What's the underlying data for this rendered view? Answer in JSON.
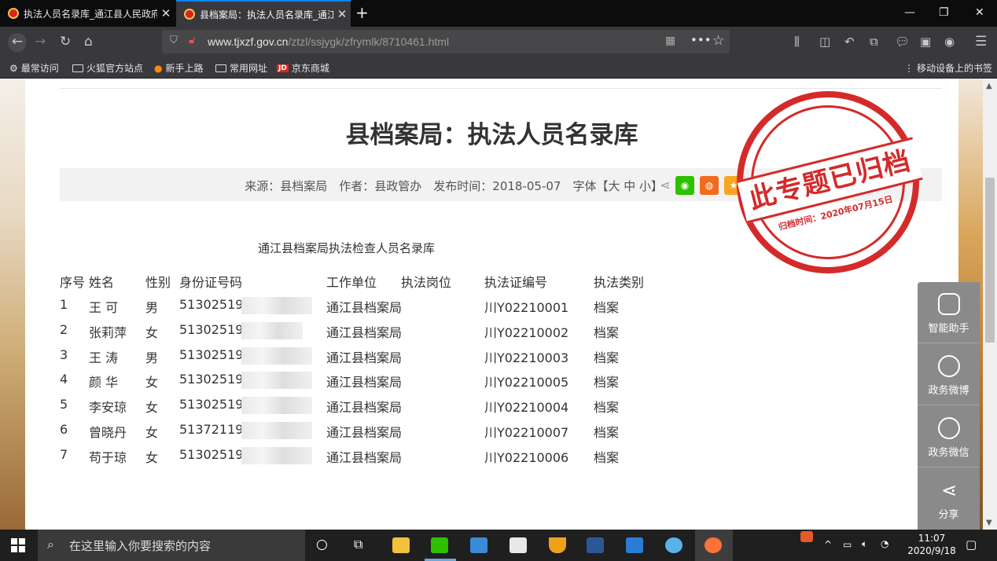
{
  "browser": {
    "tabs": [
      {
        "title": "执法人员名录库_通江县人民政府",
        "active": false
      },
      {
        "title": "县档案局：执法人员名录库_通江县",
        "active": true
      }
    ],
    "url_domain": "www.tjxzf.gov.cn",
    "url_path": "/ztzl/ssjygk/zfrymlk/8710461.html",
    "bookmarks": [
      "最常访问",
      "火狐官方站点",
      "新手上路",
      "常用网址",
      "京东商城"
    ],
    "mobile_bookmarks": "移动设备上的书签"
  },
  "article": {
    "title": "县档案局：执法人员名录库",
    "meta": "来源：县档案局　作者：县政管办　发布时间：2018-05-07　字体【大 中 小】",
    "stamp_text": "此专题已归档",
    "stamp_date": "归档时间：2020年07月15日",
    "subtitle": "通江县档案局执法检查人员名录库",
    "headers": [
      "序号",
      "姓名",
      "性别",
      "身份证号码",
      "工作单位",
      "执法岗位",
      "执法证编号",
      "执法类别"
    ],
    "rows": [
      {
        "no": "1",
        "name": "王 可",
        "sex": "男",
        "id": "513025196",
        "unit": "通江县档案局",
        "cert": "川Y02210001",
        "type": "档案"
      },
      {
        "no": "2",
        "name": "张莉萍",
        "sex": "女",
        "id": "513025196",
        "unit": "通江县档案局",
        "cert": "川Y02210002",
        "type": "档案"
      },
      {
        "no": "3",
        "name": "王 涛",
        "sex": "男",
        "id": "513025197",
        "unit": "通江县档案局",
        "cert": "川Y02210003",
        "type": "档案"
      },
      {
        "no": "4",
        "name": "颜 华",
        "sex": "女",
        "id": "513025197",
        "unit": "通江县档案局",
        "cert": "川Y02210005",
        "type": "档案"
      },
      {
        "no": "5",
        "name": "李安琼",
        "sex": "女",
        "id": "513025197",
        "unit": "通江县档案局",
        "cert": "川Y02210004",
        "type": "档案"
      },
      {
        "no": "6",
        "name": "曾晓丹",
        "sex": "女",
        "id": "513721198",
        "unit": "通江县档案局",
        "cert": "川Y02210007",
        "type": "档案"
      },
      {
        "no": "7",
        "name": "苟于琼",
        "sex": "女",
        "id": "513025196",
        "unit": "通江县档案局",
        "cert": "川Y02210006",
        "type": "档案"
      }
    ]
  },
  "float_panel": [
    "智能助手",
    "政务微博",
    "政务微信",
    "分享"
  ],
  "taskbar": {
    "search_placeholder": "在这里输入你要搜索的内容",
    "time": "11:07",
    "date": "2020/9/18"
  }
}
